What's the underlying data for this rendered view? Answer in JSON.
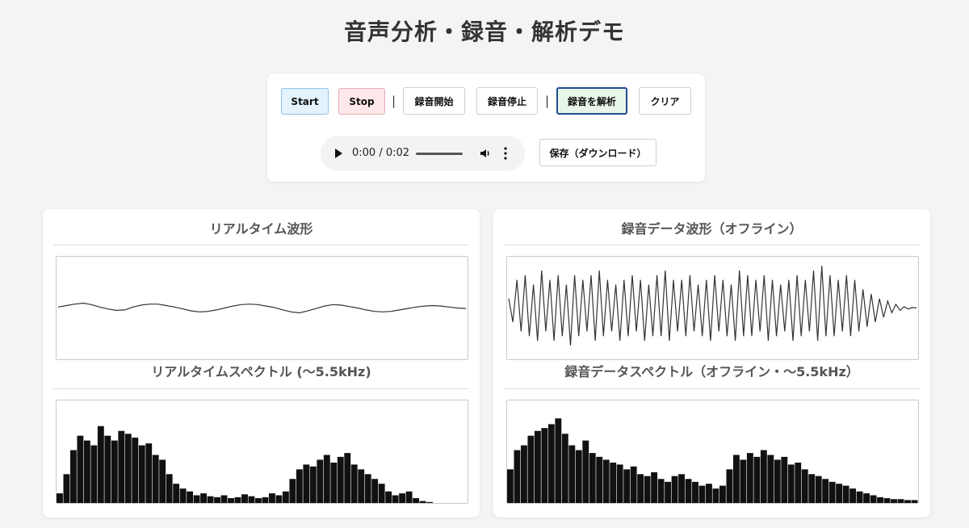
{
  "page": {
    "title": "音声分析・録音・解析デモ"
  },
  "controls": {
    "start_label": "Start",
    "stop_label": "Stop",
    "separator": "|",
    "rec_start_label": "録音開始",
    "rec_stop_label": "録音停止",
    "analyze_label": "録音を解析",
    "clear_label": "クリア",
    "save_label": "保存（ダウンロード）",
    "accent_color": "#1f4f8f"
  },
  "audio": {
    "time_display": "0:00 / 0:02",
    "progress": 0,
    "icons": [
      "play-icon",
      "volume-icon",
      "more-options-icon"
    ]
  },
  "panels": {
    "left": {
      "wave_title": "リアルタイム波形",
      "spectrum_title": "リアルタイムスペクトル (〜5.5kHz)"
    },
    "right": {
      "wave_title": "録音データ波形（オフライン）",
      "spectrum_title": "録音データスペクトル（オフライン・〜5.5kHz）"
    }
  },
  "chart_data": [
    {
      "type": "line",
      "title": "リアルタイム波形",
      "values": [
        0.02,
        0.05,
        0.08,
        0.1,
        0.07,
        0.02,
        -0.02,
        -0.05,
        -0.04,
        0.02,
        0.06,
        0.08,
        0.08,
        0.05,
        0.02,
        -0.02,
        -0.06,
        -0.08,
        -0.07,
        -0.04,
        0.0,
        0.04,
        0.07,
        0.08,
        0.07,
        0.04,
        0.01,
        -0.04,
        -0.08,
        -0.1,
        -0.06,
        -0.01,
        0.04,
        0.07,
        0.06,
        0.03,
        0.0,
        -0.04,
        -0.07,
        -0.08,
        -0.07,
        -0.04,
        -0.01,
        0.02,
        0.04,
        0.05,
        0.04,
        0.02,
        0.0,
        -0.01
      ],
      "ylim": [
        -1,
        1
      ]
    },
    {
      "type": "line",
      "title": "録音データ波形（オフライン）",
      "values": [
        0.2,
        -0.3,
        0.6,
        -0.5,
        0.7,
        -0.6,
        0.5,
        -0.7,
        0.8,
        -0.5,
        0.6,
        -0.7,
        0.7,
        -0.6,
        0.5,
        -0.8,
        0.7,
        -0.6,
        0.6,
        -0.5,
        0.7,
        -0.7,
        0.8,
        -0.6,
        0.6,
        -0.5,
        0.5,
        -0.7,
        0.6,
        -0.6,
        0.7,
        -0.5,
        0.6,
        -0.7,
        0.5,
        -0.6,
        0.7,
        -0.6,
        0.8,
        -0.7,
        0.6,
        -0.5,
        0.6,
        -0.6,
        0.7,
        -0.5,
        0.5,
        -0.6,
        0.6,
        -0.7,
        0.7,
        -0.5,
        0.6,
        -0.6,
        0.5,
        -0.7,
        0.8,
        -0.6,
        0.7,
        -0.6,
        0.6,
        -0.5,
        0.7,
        -0.7,
        0.6,
        -0.6,
        0.5,
        -0.5,
        0.6,
        -0.7,
        0.7,
        -0.6,
        0.6,
        -0.5,
        0.8,
        -0.7,
        0.9,
        -0.6,
        0.7,
        -0.6,
        0.6,
        -0.5,
        0.7,
        -0.6,
        0.6,
        -0.5,
        0.4,
        -0.4,
        0.3,
        -0.3,
        0.2,
        -0.2,
        0.15,
        -0.1,
        0.08,
        -0.05,
        0.03,
        -0.02,
        0.01,
        0.0
      ],
      "ylim": [
        -1,
        1
      ]
    },
    {
      "type": "bar",
      "title": "リアルタイムスペクトル (〜5.5kHz)",
      "xlabel": "",
      "values": [
        0.1,
        0.3,
        0.55,
        0.7,
        0.65,
        0.6,
        0.8,
        0.7,
        0.65,
        0.75,
        0.72,
        0.68,
        0.6,
        0.62,
        0.5,
        0.45,
        0.3,
        0.2,
        0.15,
        0.12,
        0.08,
        0.1,
        0.07,
        0.06,
        0.08,
        0.05,
        0.06,
        0.09,
        0.07,
        0.05,
        0.06,
        0.1,
        0.08,
        0.12,
        0.25,
        0.35,
        0.4,
        0.38,
        0.45,
        0.5,
        0.42,
        0.48,
        0.52,
        0.4,
        0.35,
        0.3,
        0.25,
        0.2,
        0.12,
        0.08,
        0.1,
        0.12,
        0.05,
        0.02,
        0.01,
        0.0,
        0.0,
        0.0,
        0.0,
        0.0
      ],
      "ylim": [
        0,
        1
      ]
    },
    {
      "type": "bar",
      "title": "録音データスペクトル（オフライン・〜5.5kHz）",
      "xlabel": "",
      "values": [
        0.35,
        0.55,
        0.6,
        0.7,
        0.75,
        0.78,
        0.82,
        0.88,
        0.72,
        0.6,
        0.55,
        0.65,
        0.52,
        0.48,
        0.45,
        0.42,
        0.4,
        0.35,
        0.38,
        0.3,
        0.28,
        0.32,
        0.25,
        0.22,
        0.28,
        0.3,
        0.25,
        0.22,
        0.18,
        0.2,
        0.15,
        0.18,
        0.35,
        0.5,
        0.45,
        0.52,
        0.48,
        0.55,
        0.5,
        0.45,
        0.48,
        0.4,
        0.42,
        0.35,
        0.3,
        0.28,
        0.25,
        0.22,
        0.2,
        0.18,
        0.15,
        0.12,
        0.1,
        0.08,
        0.06,
        0.05,
        0.04,
        0.04,
        0.03,
        0.03
      ],
      "ylim": [
        0,
        1
      ]
    }
  ]
}
